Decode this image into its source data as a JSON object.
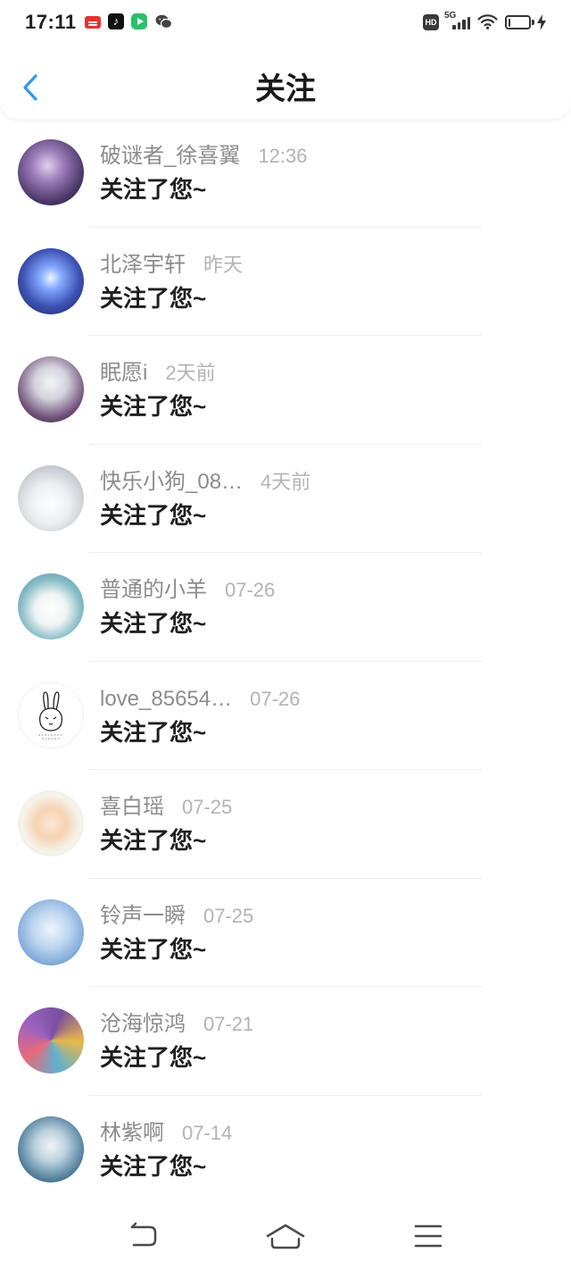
{
  "status_bar": {
    "time": "17:11",
    "left_icons": [
      "news-app-icon",
      "tiktok-icon",
      "video-app-icon",
      "wechat-icon"
    ],
    "hd_label": "HD",
    "network_label": "5G",
    "right_icons": [
      "hd-icon",
      "signal-icon",
      "wifi-icon",
      "battery-icon",
      "charging-icon"
    ],
    "battery_level": 0.1
  },
  "header": {
    "title": "关注",
    "back_icon": "back-chevron-icon"
  },
  "colors": {
    "accent": "#2b9af3"
  },
  "items": [
    {
      "name": "破谜者_徐喜翼",
      "time": "12:36",
      "message": "关注了您~"
    },
    {
      "name": "北泽宇轩",
      "time": "昨天",
      "message": "关注了您~"
    },
    {
      "name": "眠愿i",
      "time": "2天前",
      "message": "关注了您~"
    },
    {
      "name": "快乐小狗_08…",
      "time": "4天前",
      "message": "关注了您~"
    },
    {
      "name": "普通的小羊",
      "time": "07-26",
      "message": "关注了您~"
    },
    {
      "name": "love_85654…",
      "time": "07-26",
      "message": "关注了您~"
    },
    {
      "name": "喜白瑶",
      "time": "07-25",
      "message": "关注了您~"
    },
    {
      "name": "铃声一瞬",
      "time": "07-25",
      "message": "关注了您~"
    },
    {
      "name": "沧海惊鸿",
      "time": "07-21",
      "message": "关注了您~"
    },
    {
      "name": "林紫啊",
      "time": "07-14",
      "message": "关注了您~"
    }
  ],
  "bottom_nav": {
    "icons": [
      "nav-back-icon",
      "nav-home-icon",
      "nav-menu-icon"
    ]
  }
}
